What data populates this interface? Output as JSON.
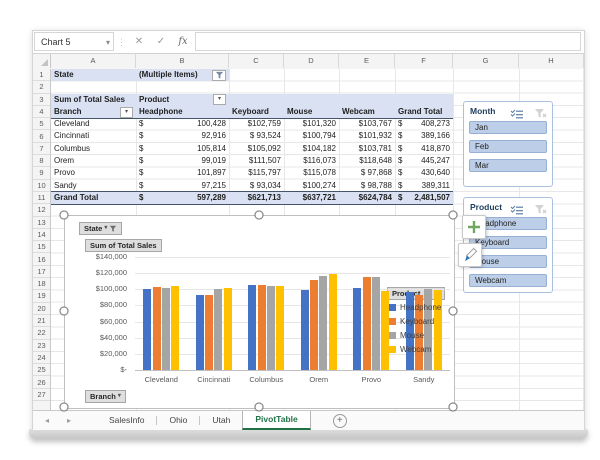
{
  "name_box": {
    "value": "Chart 5"
  },
  "formula_bar": {
    "value": ""
  },
  "icons": {
    "name_box_dropdown": "▾",
    "separator": "⋮",
    "cancel": "✕",
    "enter": "✓",
    "fx": "fx",
    "dropdown": "▾",
    "tab_scroll_left": "◂",
    "tab_scroll_right": "▸",
    "add_sheet": "+"
  },
  "grid": {
    "columns": [
      "A",
      "B",
      "C",
      "D",
      "E",
      "F",
      "G",
      "H"
    ],
    "row_count": 27
  },
  "pivot": {
    "page_field": {
      "label": "State",
      "value": "(Multiple Items)"
    },
    "values_label": "Sum of Total Sales",
    "column_field": "Product",
    "row_field": "Branch",
    "column_headers": [
      "Headphone",
      "Keyboard",
      "Mouse",
      "Webcam",
      "Grand Total"
    ],
    "currency": "$",
    "rows": [
      {
        "branch": "Cleveland",
        "headphone": "100,428",
        "keyboard": "$102,759",
        "mouse": "$101,320",
        "webcam": "$103,767",
        "total": "408,273"
      },
      {
        "branch": "Cincinnati",
        "headphone": "92,916",
        "keyboard": "$ 93,524",
        "mouse": "$100,794",
        "webcam": "$101,932",
        "total": "389,166"
      },
      {
        "branch": "Columbus",
        "headphone": "105,814",
        "keyboard": "$105,092",
        "mouse": "$104,182",
        "webcam": "$103,781",
        "total": "418,870"
      },
      {
        "branch": "Orem",
        "headphone": "99,019",
        "keyboard": "$111,507",
        "mouse": "$116,073",
        "webcam": "$118,648",
        "total": "445,247"
      },
      {
        "branch": "Provo",
        "headphone": "101,897",
        "keyboard": "$115,797",
        "mouse": "$115,078",
        "webcam": "$ 97,868",
        "total": "430,640"
      },
      {
        "branch": "Sandy",
        "headphone": "97,215",
        "keyboard": "$ 93,034",
        "mouse": "$100,274",
        "webcam": "$ 98,788",
        "total": "389,311"
      },
      {
        "branch": "Grand Total",
        "headphone": "597,289",
        "keyboard": "$621,713",
        "mouse": "$637,721",
        "webcam": "$624,784",
        "total": "2,481,507"
      }
    ]
  },
  "slicers": [
    {
      "title": "Month",
      "items": [
        "Jan",
        "Feb",
        "Mar"
      ]
    },
    {
      "title": "Product",
      "items": [
        "Headphone",
        "Keyboard",
        "Mouse",
        "Webcam"
      ]
    }
  ],
  "chart_data": {
    "type": "bar",
    "title": "",
    "field_buttons": {
      "page": "State",
      "value": "Sum of Total Sales",
      "axis": "Branch",
      "legend": "Product"
    },
    "categories": [
      "Cleveland",
      "Cincinnati",
      "Columbus",
      "Orem",
      "Provo",
      "Sandy"
    ],
    "series": [
      {
        "name": "Headphone",
        "color": "#4472C4",
        "values": [
          100428,
          92916,
          105814,
          99019,
          101897,
          97215
        ]
      },
      {
        "name": "Keyboard",
        "color": "#ED7D31",
        "values": [
          102759,
          93524,
          105092,
          111507,
          115797,
          93034
        ]
      },
      {
        "name": "Mouse",
        "color": "#A5A5A5",
        "values": [
          101320,
          100794,
          104182,
          116073,
          115078,
          100274
        ]
      },
      {
        "name": "Webcam",
        "color": "#FFC000",
        "values": [
          103767,
          101932,
          103781,
          118648,
          97868,
          98788
        ]
      }
    ],
    "ylim": [
      0,
      140000
    ],
    "ytick_step": 20000,
    "ytick_labels": [
      "$140,000",
      "$120,000",
      "$100,000",
      "$80,000",
      "$60,000",
      "$40,000",
      "$20,000",
      "$-"
    ],
    "grid": true,
    "legend_position": "right"
  },
  "sheet_tabs": {
    "tabs": [
      {
        "label": "SalesInfo",
        "active": false
      },
      {
        "label": "Ohio",
        "active": false
      },
      {
        "label": "Utah",
        "active": false
      },
      {
        "label": "PivotTable",
        "active": true
      }
    ]
  },
  "colors": {
    "pivot_fill": "#D9E1F2",
    "pivot_border": "#44546A",
    "slicer_item_fill": "#BCCEE8",
    "active_tab_green": "#217346",
    "chart_plus_green": "#6FA760",
    "brush_blue": "#2E75B6"
  }
}
